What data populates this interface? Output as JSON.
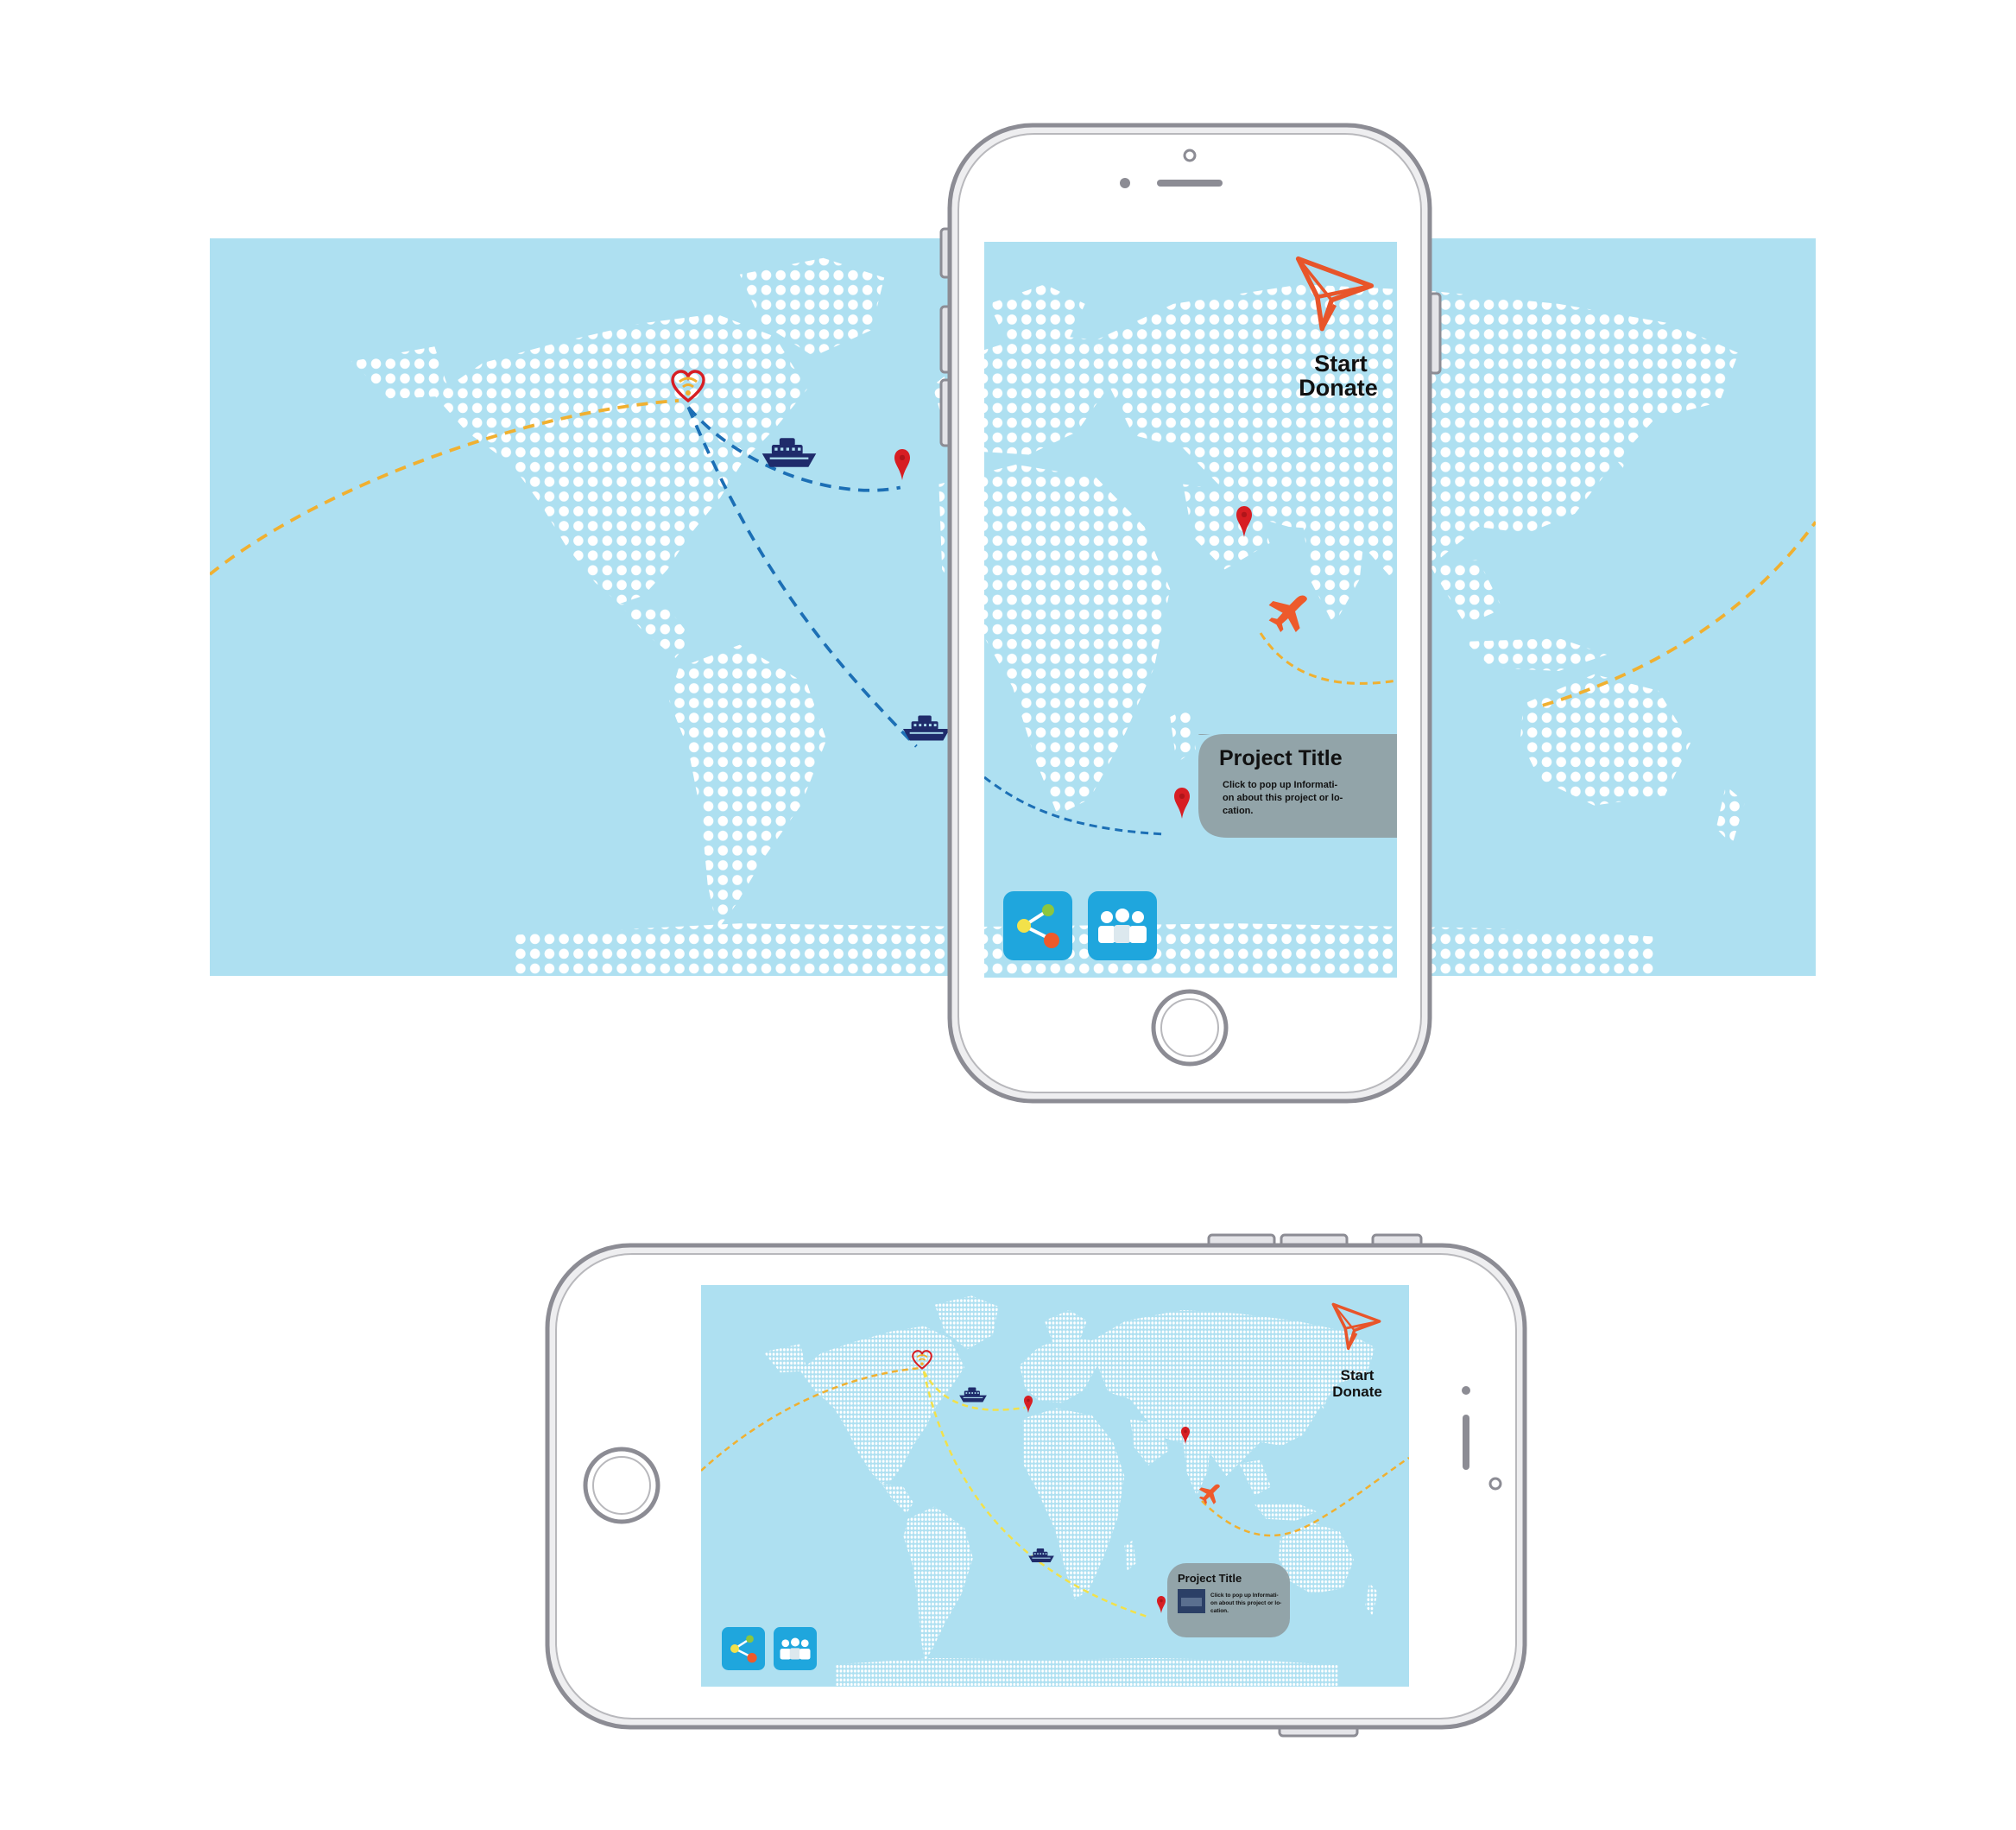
{
  "colors": {
    "ocean": "#aee0f1",
    "land_dots": "#ffffff",
    "route_orange": "#f0b030",
    "route_blue": "#1c6fb5",
    "route_yellow": "#f2e14a",
    "ship": "#1f2b6b",
    "pin": "#d71e23",
    "plane": "#ee5a2b",
    "accent_orange": "#e8552a",
    "button_blue": "#1fa6dd",
    "popup_gray": "#8f9ea3",
    "phone_frame": "#8c8c94"
  },
  "donate": {
    "line1": "Start",
    "line2": "Donate",
    "icon": "paper-plane-icon"
  },
  "project_card": {
    "title": "Project Title",
    "body_lines": [
      "Click to pop up Informati-",
      "on about this project or lo-",
      "cation."
    ]
  },
  "buttons": {
    "share": {
      "icon": "share-icon"
    },
    "people": {
      "icon": "people-group-icon"
    }
  },
  "map_markers": {
    "origin": "heart-signal-icon",
    "ship": "ship-icon",
    "pin": "map-pin-icon",
    "plane": "airplane-icon"
  }
}
